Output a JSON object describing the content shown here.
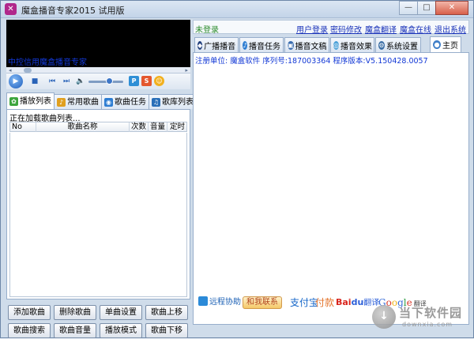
{
  "window": {
    "title": "魔盒播音专家2015 试用版",
    "app_icon_glyph": "✕",
    "controls": {
      "minimize": "—",
      "maximize": "□",
      "close": "✕"
    }
  },
  "left": {
    "marquee": "中控信用魔盒播音专家",
    "player_icons": {
      "play": "▶",
      "stop": "■",
      "prev": "⏮",
      "next": "⏭",
      "volume": "🔈",
      "seek_left": "◂",
      "seek_right": "▸"
    },
    "volume_level": 0.5,
    "extra_icons": [
      {
        "name": "p-icon",
        "glyph": "P",
        "color": "#2f8fd6"
      },
      {
        "name": "refresh-icon",
        "glyph": "S",
        "color": "#e4572e"
      },
      {
        "name": "emoji-icon",
        "glyph": "☺",
        "color": "#f2b01e"
      }
    ],
    "tabs": [
      {
        "label": "播放列表",
        "icon": "✿",
        "color": "#3da53d",
        "active": true
      },
      {
        "label": "常用歌曲",
        "icon": "♪",
        "color": "#e0a020"
      },
      {
        "label": "歌曲任务",
        "icon": "◉",
        "color": "#2d7dd2"
      },
      {
        "label": "歌库列表",
        "icon": "♫",
        "color": "#2a6fb8"
      }
    ],
    "loading_text": "正在加载歌曲列表...",
    "columns": [
      "No",
      "歌曲名称",
      "次数",
      "音量",
      "定时"
    ],
    "buttons": [
      [
        "添加歌曲",
        "删除歌曲",
        "单曲设置",
        "歌曲上移"
      ],
      [
        "歌曲搜索",
        "歌曲音量",
        "播放模式",
        "歌曲下移"
      ]
    ]
  },
  "right": {
    "login_status": "未登录",
    "links": [
      "用户登录",
      "密码修改",
      "魔盒翻译",
      "魔盒在线",
      "退出系统"
    ],
    "tabs": [
      {
        "label": "广播播音",
        "icon": "◆",
        "color": "#1f3e7c"
      },
      {
        "label": "播音任务",
        "icon": "♪",
        "color": "#2d7dd2"
      },
      {
        "label": "播音文稿",
        "icon": "▣",
        "color": "#3a6db0"
      },
      {
        "label": "播音效果",
        "icon": "◎",
        "color": "#4aa0d8"
      },
      {
        "label": "系统设置",
        "icon": "⚙",
        "color": "#3b6ea5"
      },
      {
        "label": "主页",
        "icon": "●",
        "color": "#3f7fc8",
        "active": true
      }
    ],
    "reg_info": {
      "unit_label": "注册单位:",
      "unit_value": "魔盒软件",
      "serial_label": "序列号:",
      "serial_value": "187003364",
      "version_label": "程序版本:",
      "version_value": "V5.150428.0057"
    },
    "logos": {
      "remote": "远程协助",
      "contact": "和我联系",
      "alipay": "支付宝",
      "fukuan": "付款",
      "baidu_a": "Bai",
      "baidu_b": "du",
      "baidu_fy": "翻译",
      "google": "Google",
      "google_fy": "翻译"
    }
  },
  "watermark": {
    "title": "当下软件园",
    "url": "downxia.com"
  }
}
